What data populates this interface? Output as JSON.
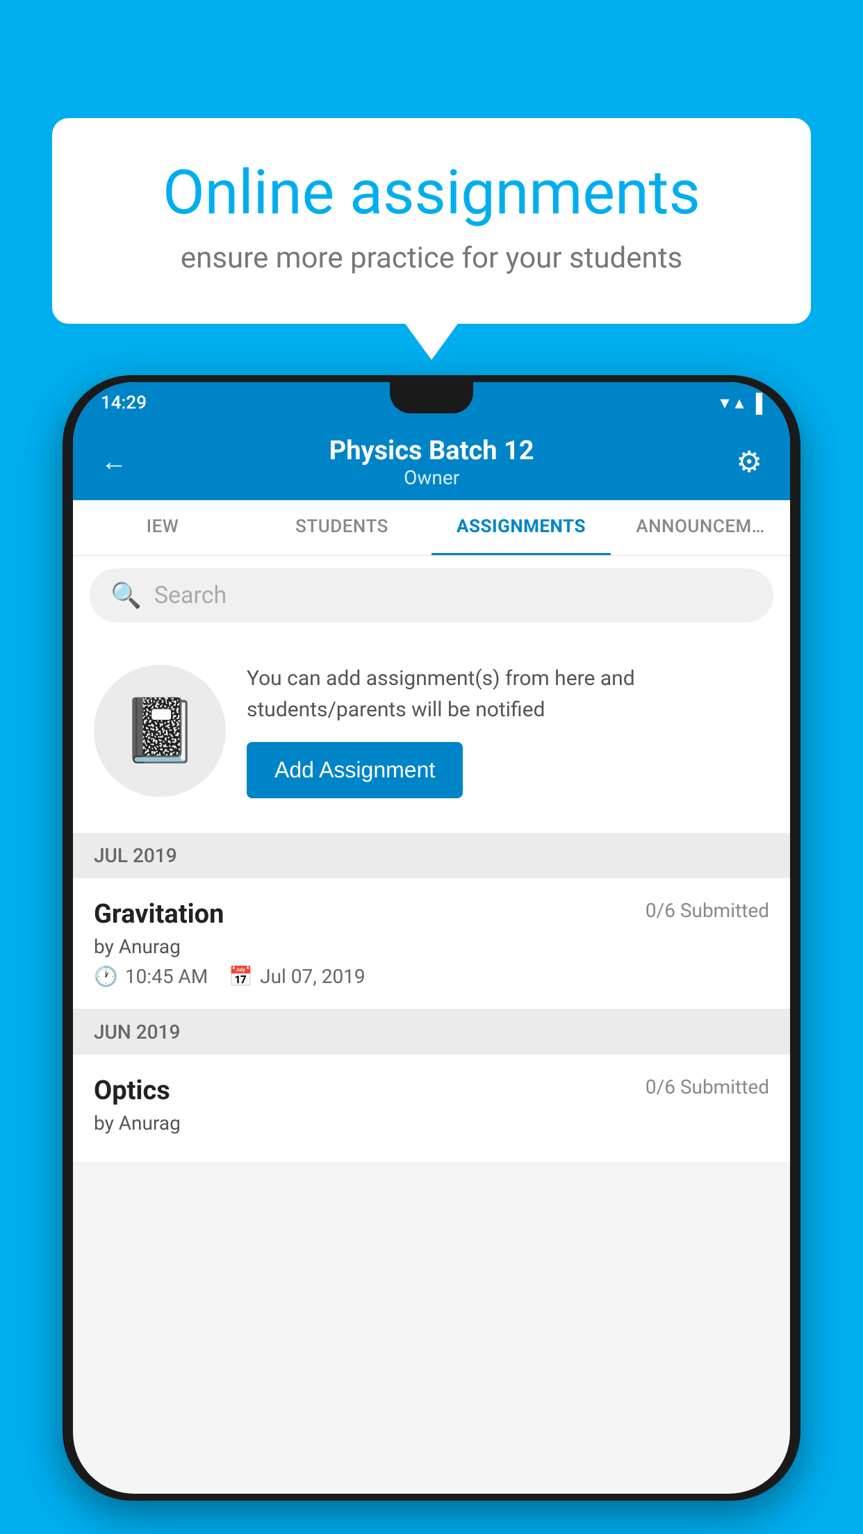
{
  "background": {
    "color": "#00AEEF"
  },
  "speech_bubble": {
    "title": "Online assignments",
    "subtitle": "ensure more practice for your students"
  },
  "status_bar": {
    "time": "14:29",
    "wifi_icon": "▼",
    "signal_icon": "▲",
    "battery_icon": "▐"
  },
  "top_bar": {
    "title": "Physics Batch 12",
    "subtitle": "Owner",
    "back_label": "←",
    "settings_label": "⚙"
  },
  "tabs": [
    {
      "label": "IEW",
      "active": false
    },
    {
      "label": "STUDENTS",
      "active": false
    },
    {
      "label": "ASSIGNMENTS",
      "active": true
    },
    {
      "label": "ANNOUNCEM…",
      "active": false
    }
  ],
  "search": {
    "placeholder": "Search"
  },
  "add_assignment_section": {
    "description": "You can add assignment(s) from here and students/parents will be notified",
    "button_label": "Add Assignment"
  },
  "sections": [
    {
      "month_label": "JUL 2019",
      "assignments": [
        {
          "name": "Gravitation",
          "submitted": "0/6 Submitted",
          "by": "by Anurag",
          "time": "10:45 AM",
          "date": "Jul 07, 2019"
        }
      ]
    },
    {
      "month_label": "JUN 2019",
      "assignments": [
        {
          "name": "Optics",
          "submitted": "0/6 Submitted",
          "by": "by Anurag",
          "time": "",
          "date": ""
        }
      ]
    }
  ],
  "icons": {
    "back": "←",
    "settings": "⚙",
    "search": "🔍",
    "clock": "🕐",
    "calendar": "📅",
    "notebook": "📓"
  }
}
